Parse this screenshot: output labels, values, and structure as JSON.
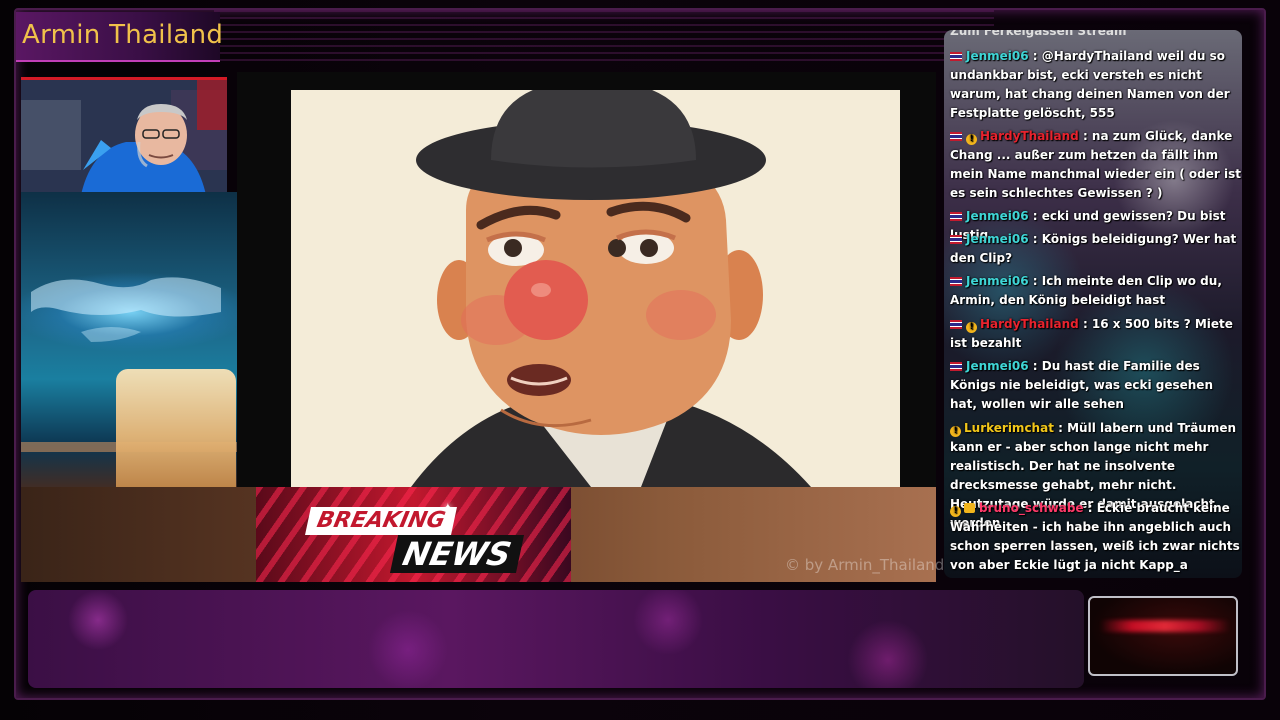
{
  "channel": {
    "title": "Armin Thailand",
    "watermark": "© by Armin_Thailand"
  },
  "news": {
    "breaking": "BREAKING",
    "news": "NEWS"
  },
  "chat": {
    "top_cut": "Zum Ferkelgassen Stream",
    "messages": [
      {
        "user": "Jenmei06",
        "text": ": @HardyThailand weil du so undankbar bist, ecki versteh es nicht warum, hat chang deinen Namen von der Festplatte gelöscht, 555"
      },
      {
        "user": "HardyThailand",
        "text": ": na zum Glück, danke Chang ... außer zum hetzen da fällt ihm mein Name manchmal wieder ein ( oder ist es sein schlechtes Gewissen ? )"
      },
      {
        "user": "Jenmei06",
        "text": ": ecki und gewissen? Du bist lustig"
      },
      {
        "user": "Jenmei06",
        "text": ": Königs beleidigung? Wer hat den Clip?"
      },
      {
        "user": "Jenmei06",
        "text": ": Ich meinte den Clip wo du, Armin, den König beleidigt hast"
      },
      {
        "user": "HardyThailand",
        "text": ": 16 x 500 bits ? Miete ist bezahlt"
      },
      {
        "user": "Jenmei06",
        "text": ": Du hast die Familie des Königs nie beleidigt, was ecki gesehen hat, wollen wir alle sehen"
      },
      {
        "user": "Lurkerimchat",
        "text": ": Müll labern und Träumen kann er - aber schon lange nicht mehr realistisch. Der hat ne insolvente drecksmesse gehabt, mehr nicht. Heutzutage würde er damit ausgelacht werden"
      },
      {
        "user": "bruno_schwabe",
        "text": ": Eckie braucht keine Wahrheiten - ich habe ihn angeblich auch schon sperren lassen, weiß ich zwar nichts von aber Eckie lügt ja nicht Kapp_a"
      }
    ]
  },
  "colors": {
    "title": "#f0c24a",
    "accent": "#c23fb8",
    "breaking_red": "#c2182e",
    "user_teal": "#3fd6d6",
    "user_red": "#e8232e",
    "user_yellow": "#f2c71a",
    "user_pink": "#ff3a6a"
  }
}
